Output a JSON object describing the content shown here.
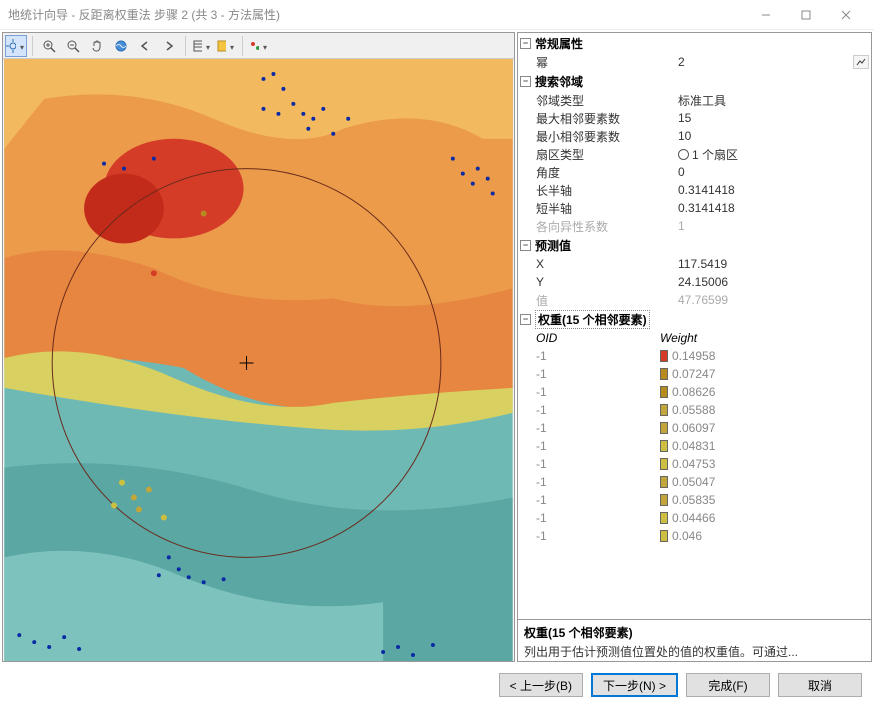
{
  "window": {
    "title": "地统计向导 - 反距离权重法 步骤 2 (共 3 - 方法属性)"
  },
  "sections": {
    "general": {
      "title": "常规属性",
      "power_label": "幂",
      "power_value": "2"
    },
    "search": {
      "title": "搜索邻域",
      "neighborhood_type_label": "邻域类型",
      "neighborhood_type_value": "标准工具",
      "max_neighbors_label": "最大相邻要素数",
      "max_neighbors_value": "15",
      "min_neighbors_label": "最小相邻要素数",
      "min_neighbors_value": "10",
      "sector_type_label": "扇区类型",
      "sector_type_value": "1 个扇区",
      "angle_label": "角度",
      "angle_value": "0",
      "major_axis_label": "长半轴",
      "major_axis_value": "0.3141418",
      "minor_axis_label": "短半轴",
      "minor_axis_value": "0.3141418",
      "anisotropy_label": "各向异性系数",
      "anisotropy_value": "1"
    },
    "predicted": {
      "title": "预测值",
      "x_label": "X",
      "x_value": "117.5419",
      "y_label": "Y",
      "y_value": "24.15006",
      "value_label": "值",
      "value_value": "47.76599"
    },
    "weights_section": {
      "title": "权重(15 个相邻要素)",
      "col_oid": "OID",
      "col_weight": "Weight"
    }
  },
  "weights": [
    {
      "oid": "-1",
      "weight": "0.14958",
      "color": "#d43c28"
    },
    {
      "oid": "-1",
      "weight": "0.07247",
      "color": "#b78a1f"
    },
    {
      "oid": "-1",
      "weight": "0.08626",
      "color": "#b78a1f"
    },
    {
      "oid": "-1",
      "weight": "0.05588",
      "color": "#c3a63a"
    },
    {
      "oid": "-1",
      "weight": "0.06097",
      "color": "#c3a63a"
    },
    {
      "oid": "-1",
      "weight": "0.04831",
      "color": "#cdbf3f"
    },
    {
      "oid": "-1",
      "weight": "0.04753",
      "color": "#cdbf3f"
    },
    {
      "oid": "-1",
      "weight": "0.05047",
      "color": "#c3a63a"
    },
    {
      "oid": "-1",
      "weight": "0.05835",
      "color": "#c3a63a"
    },
    {
      "oid": "-1",
      "weight": "0.04466",
      "color": "#cdbf3f"
    },
    {
      "oid": "-1",
      "weight": "0.046",
      "color": "#cdbf3f"
    }
  ],
  "help": {
    "title": "权重(15 个相邻要素)",
    "desc": "列出用于估计预测值位置处的值的权重值。可通过..."
  },
  "buttons": {
    "back": "< 上一步(B)",
    "next": "下一步(N) >",
    "finish": "完成(F)",
    "cancel": "取消"
  }
}
